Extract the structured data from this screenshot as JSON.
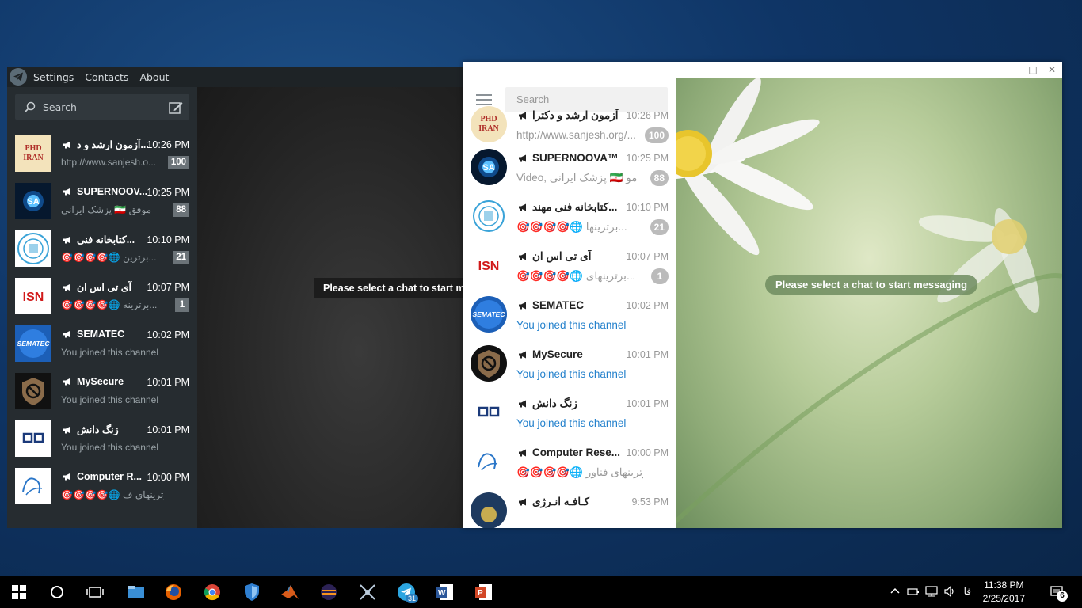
{
  "dark_window": {
    "menu": [
      "Settings",
      "Contacts",
      "About"
    ],
    "search_placeholder": "Search",
    "empty_message": "Please select a chat to start m",
    "chats": [
      {
        "name": "آزمون ارشد و د...",
        "time": "10:26 PM",
        "preview": "http://www.sanjesh.o...",
        "badge": "100",
        "avatar": "phd"
      },
      {
        "name": "SUPERNOOV...",
        "time": "10:25 PM",
        "preview": "پزشک ایرانی 🇮🇷 موفق",
        "badge": "88",
        "avatar": "sa"
      },
      {
        "name": "کتابخانه فنی...",
        "time": "10:10 PM",
        "preview": "🎯🎯🎯🎯🌐 برترین...",
        "badge": "21",
        "avatar": "uni"
      },
      {
        "name": "آی تی اس ان",
        "time": "10:07 PM",
        "preview": "🎯🎯🎯🎯🌐 برترینه...",
        "badge": "1",
        "avatar": "itsn"
      },
      {
        "name": "SEMATEC",
        "time": "10:02 PM",
        "preview": "You joined this channel",
        "badge": "",
        "avatar": "sematec"
      },
      {
        "name": "MySecure",
        "time": "10:01 PM",
        "preview": "You joined this channel",
        "badge": "",
        "avatar": "secure"
      },
      {
        "name": "زنگ دانش",
        "time": "10:01 PM",
        "preview": "You joined this channel",
        "badge": "",
        "avatar": "zang"
      },
      {
        "name": "Computer R...",
        "time": "10:00 PM",
        "preview": "🎯🎯🎯🎯🌐 برترینهای ف...",
        "badge": "",
        "avatar": "computer"
      }
    ]
  },
  "light_window": {
    "search_placeholder": "Search",
    "empty_message": "Please select a chat to start messaging",
    "chats": [
      {
        "name": "آزمون ارشد و دکترا",
        "time": "10:26 PM",
        "preview": "http://www.sanjesh.org/...",
        "badge": "100",
        "avatar": "phd",
        "joined": false
      },
      {
        "name": "SUPERNOOVA™",
        "time": "10:25 PM",
        "preview": "Video, پزشک ایرانی 🇮🇷 مو",
        "badge": "88",
        "avatar": "sa",
        "joined": false
      },
      {
        "name": "کتابخانه فنی مهند...",
        "time": "10:10 PM",
        "preview": "🎯🎯🎯🎯🌐 برترینها...",
        "badge": "21",
        "avatar": "uni",
        "joined": false
      },
      {
        "name": "آی تی اس ان",
        "time": "10:07 PM",
        "preview": "🎯🎯🎯🎯🌐 برترینهای...",
        "badge": "1",
        "avatar": "itsn",
        "joined": false
      },
      {
        "name": "SEMATEC",
        "time": "10:02 PM",
        "preview": "You joined this channel",
        "badge": "",
        "avatar": "sematec",
        "joined": true
      },
      {
        "name": "MySecure",
        "time": "10:01 PM",
        "preview": "You joined this channel",
        "badge": "",
        "avatar": "secure",
        "joined": true
      },
      {
        "name": "زنگ دانش",
        "time": "10:01 PM",
        "preview": "You joined this channel",
        "badge": "",
        "avatar": "zang",
        "joined": true
      },
      {
        "name": "Computer Rese...",
        "time": "10:00 PM",
        "preview": "🎯🎯🎯🎯🌐 برترینهای فناور...",
        "badge": "",
        "avatar": "computer",
        "joined": false
      },
      {
        "name": "کـافـه انـرژی",
        "time": "9:53 PM",
        "preview": "",
        "badge": "",
        "avatar": "cafe",
        "joined": false
      }
    ]
  },
  "taskbar": {
    "apps": [
      "start",
      "cortana",
      "task-view",
      "file-explorer",
      "firefox",
      "chrome",
      "security-shield",
      "matlab",
      "eclipse",
      "network-tool",
      "telegram",
      "word",
      "powerpoint"
    ],
    "telegram_count": "31",
    "language": "فا",
    "time": "11:38 PM",
    "date": "2/25/2017",
    "notifications": "6"
  },
  "colors": {
    "telegram_blue": "#2481cc",
    "badge_gray": "#bbbbbb"
  }
}
